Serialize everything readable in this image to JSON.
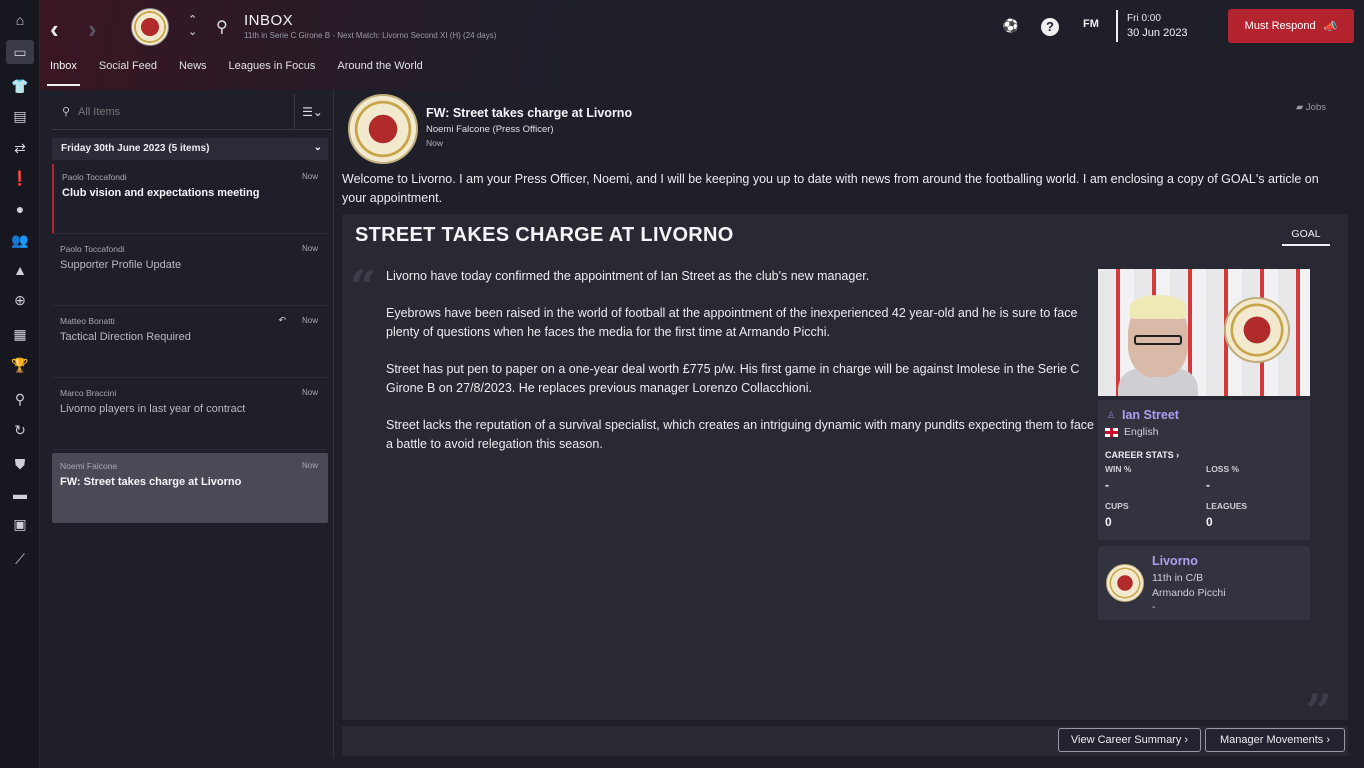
{
  "sidebar": {
    "items": [
      "home-icon",
      "inbox-icon",
      "squad-icon",
      "tactics-icon",
      "transfers-icon",
      "medical-icon",
      "data-hub-icon",
      "staff-icon",
      "training-icon",
      "dynamics-icon",
      "schedule-icon",
      "competitions-icon",
      "scouting-icon",
      "transfers-cycle-icon",
      "club-info-icon",
      "finances-icon",
      "dev-centre-icon",
      "report-icon"
    ]
  },
  "topbar": {
    "title": "INBOX",
    "subtitle": "11th in Serie C Girone B - Next Match: Livorno Second XI (H) (24 days)",
    "logo_text": "FM",
    "date_time": "Fri 0:00",
    "date": "30 Jun 2023",
    "must_respond": "Must Respond"
  },
  "tabs": [
    "Inbox",
    "Social Feed",
    "News",
    "Leagues in Focus",
    "Around the World"
  ],
  "inbox": {
    "search_placeholder": "All Items",
    "group_header": "Friday 30th June 2023 (5 items)",
    "messages": [
      {
        "sender": "Paolo Toccafondi",
        "time": "Now",
        "subject": "Club vision and expectations meeting"
      },
      {
        "sender": "Paolo Toccafondi",
        "time": "Now",
        "subject": "Supporter Profile Update"
      },
      {
        "sender": "Matteo Bonatti",
        "time": "Now",
        "subject": "Tactical Direction Required"
      },
      {
        "sender": "Marco Braccini",
        "time": "Now",
        "subject": "Livorno players in last year of contract"
      },
      {
        "sender": "Noemi Falcone",
        "time": "Now",
        "subject": "FW: Street takes charge at Livorno"
      }
    ]
  },
  "message": {
    "title": "FW: Street takes charge at Livorno",
    "from": "Noemi Falcone  (Press Officer)",
    "time": "Now",
    "jobs_label": "Jobs",
    "intro": "Welcome to Livorno. I am your Press Officer, Noemi, and I will be keeping you up to date with news from around the footballing world. I am enclosing a copy of GOAL's article on your appointment."
  },
  "article": {
    "headline": "STREET TAKES CHARGE AT LIVORNO",
    "source": "GOAL",
    "paragraphs": [
      "Livorno have today confirmed the appointment of Ian Street as the club's new manager.",
      "Eyebrows have been raised in the world of football at the appointment of the inexperienced 42 year-old and he is sure to face plenty of questions when he faces the media for the first time at Armando Picchi.",
      "Street has put pen to paper on a one-year deal worth £775 p/w. His first game in charge will be against Imolese in the Serie C Girone B on 27/8/2023. He replaces previous manager Lorenzo Collacchioni.",
      "Street lacks the reputation of a survival specialist, which creates an intriguing dynamic with many pundits expecting them to face a battle to avoid relegation this season."
    ]
  },
  "person": {
    "name": "Ian Street",
    "nationality": "English",
    "career_stats_label": "CAREER STATS",
    "win_label": "WIN %",
    "win_value": "-",
    "loss_label": "LOSS %",
    "loss_value": "-",
    "cups_label": "CUPS",
    "cups_value": "0",
    "leagues_label": "LEAGUES",
    "leagues_value": "0"
  },
  "club": {
    "name": "Livorno",
    "position": "11th in C/B",
    "stadium": "Armando Picchi",
    "extra": "-"
  },
  "buttons": {
    "career_summary": "View Career Summary",
    "manager_movements": "Manager Movements"
  },
  "colors": {
    "accent": "#b3242e",
    "link": "#a9a0f0",
    "background": "#1f1f2a"
  }
}
